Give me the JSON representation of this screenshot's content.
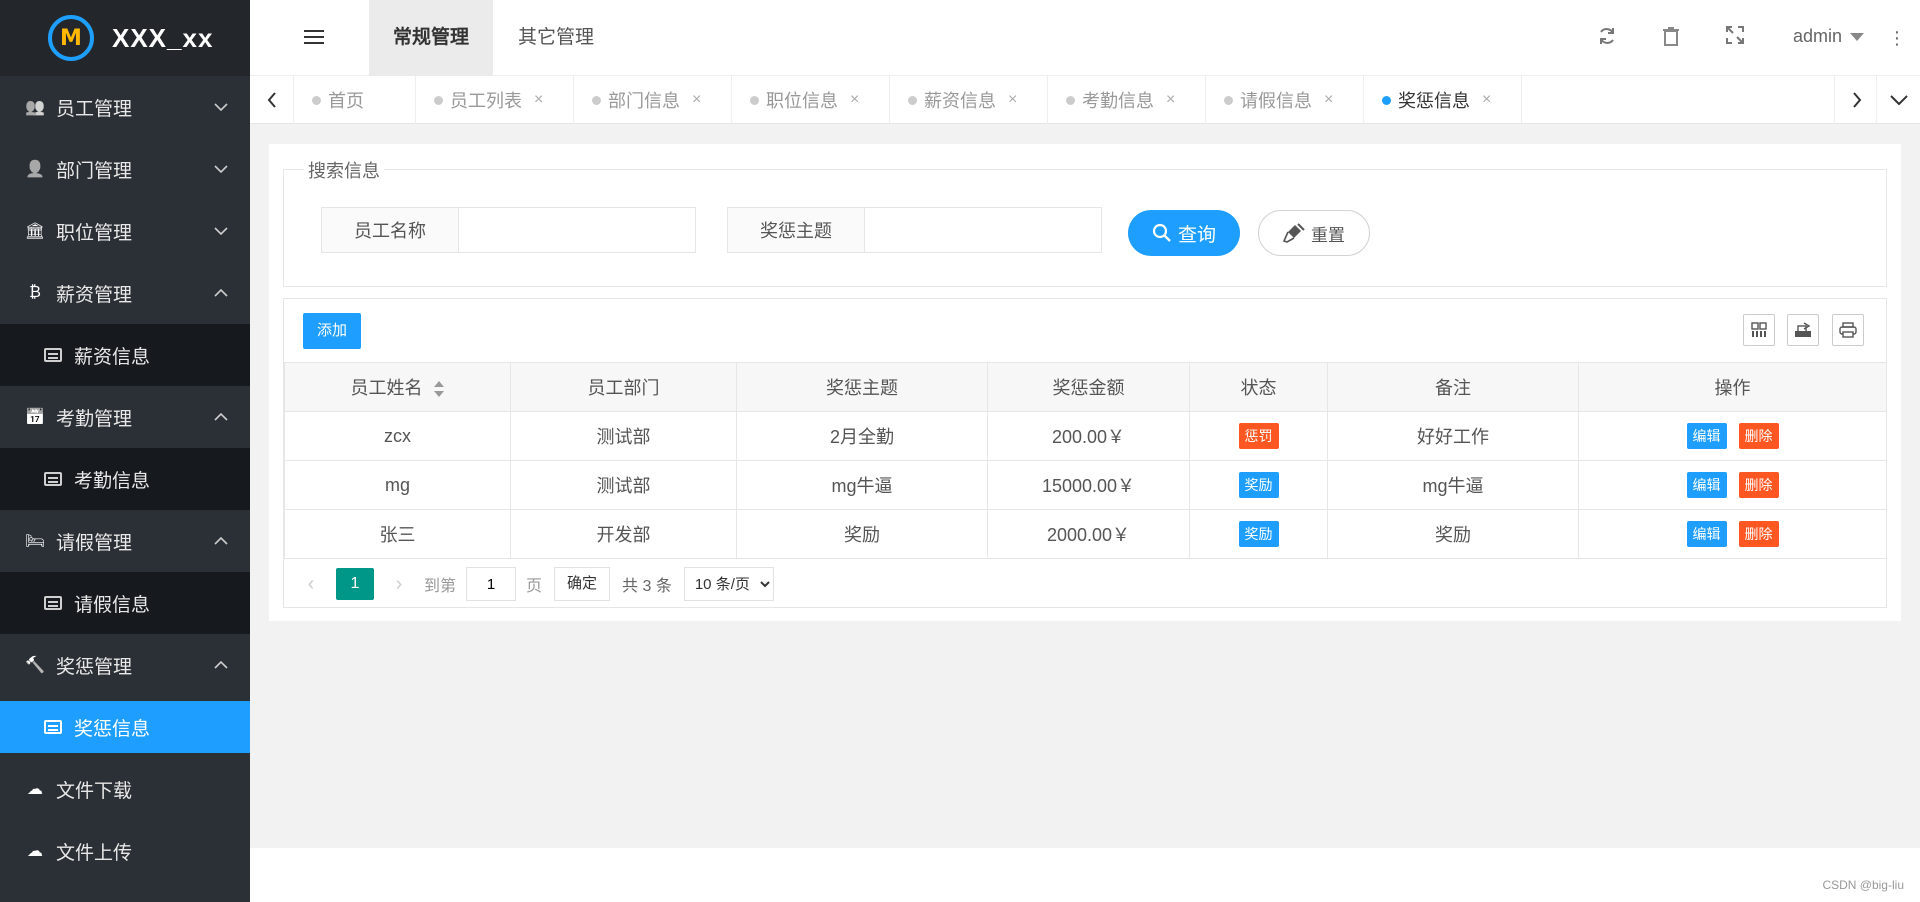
{
  "app": {
    "title": "XXX_xx",
    "logo_mark": "M"
  },
  "sidebar": {
    "items": [
      {
        "label": "员工管理",
        "icon": "users-icon",
        "expanded": false
      },
      {
        "label": "部门管理",
        "icon": "user-icon",
        "expanded": false
      },
      {
        "label": "职位管理",
        "icon": "bank-icon",
        "expanded": false
      },
      {
        "label": "薪资管理",
        "icon": "bitcoin-icon",
        "expanded": true,
        "sub": "薪资信息"
      },
      {
        "label": "考勤管理",
        "icon": "calendar-icon",
        "expanded": true,
        "sub": "考勤信息"
      },
      {
        "label": "请假管理",
        "icon": "bed-icon",
        "expanded": true,
        "sub": "请假信息"
      },
      {
        "label": "奖惩管理",
        "icon": "gavel-icon",
        "expanded": true,
        "sub": "奖惩信息"
      },
      {
        "label": "文件下载",
        "icon": "cloud-download-icon",
        "expanded": false
      },
      {
        "label": "文件上传",
        "icon": "cloud-upload-icon",
        "expanded": false
      }
    ]
  },
  "header": {
    "tabs": [
      "常规管理",
      "其它管理"
    ],
    "active_tab": 0,
    "user": "admin"
  },
  "page_tabs": [
    {
      "label": "首页",
      "closable": false
    },
    {
      "label": "员工列表",
      "closable": true
    },
    {
      "label": "部门信息",
      "closable": true
    },
    {
      "label": "职位信息",
      "closable": true
    },
    {
      "label": "薪资信息",
      "closable": true
    },
    {
      "label": "考勤信息",
      "closable": true
    },
    {
      "label": "请假信息",
      "closable": true
    },
    {
      "label": "奖惩信息",
      "closable": true,
      "active": true
    }
  ],
  "search": {
    "legend": "搜索信息",
    "employee_label": "员工名称",
    "employee_value": "",
    "subject_label": "奖惩主题",
    "subject_value": "",
    "query_label": "查询",
    "reset_label": "重置"
  },
  "table": {
    "add_label": "添加",
    "headers": [
      "员工姓名",
      "员工部门",
      "奖惩主题",
      "奖惩金额",
      "状态",
      "备注",
      "操作"
    ],
    "rows": [
      {
        "name": "zcx",
        "dept": "测试部",
        "subject": "2月全勤",
        "amount": "200.00￥",
        "status": "惩罚",
        "status_type": "penalty",
        "note": "好好工作"
      },
      {
        "name": "mg",
        "dept": "测试部",
        "subject": "mg牛逼",
        "amount": "15000.00￥",
        "status": "奖励",
        "status_type": "reward",
        "note": "mg牛逼"
      },
      {
        "name": "张三",
        "dept": "开发部",
        "subject": "奖励",
        "amount": "2000.00￥",
        "status": "奖励",
        "status_type": "reward",
        "note": "奖励"
      }
    ],
    "edit_label": "编辑",
    "delete_label": "删除"
  },
  "pager": {
    "current": "1",
    "goto_prefix": "到第",
    "goto_value": "1",
    "goto_suffix": "页",
    "ok_label": "确定",
    "total": "共 3 条",
    "page_size": "10 条/页"
  },
  "watermark": "CSDN @big-liu",
  "colors": {
    "primary": "#1e9fff",
    "danger": "#ff5722",
    "pager": "#009688",
    "sidebar": "#2b3036"
  }
}
